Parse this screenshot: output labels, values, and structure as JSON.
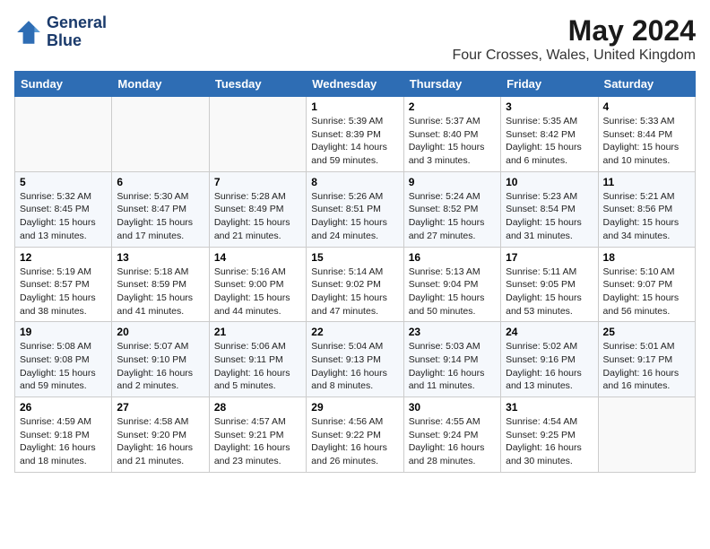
{
  "header": {
    "logo_line1": "General",
    "logo_line2": "Blue",
    "title": "May 2024",
    "subtitle": "Four Crosses, Wales, United Kingdom"
  },
  "days_of_week": [
    "Sunday",
    "Monday",
    "Tuesday",
    "Wednesday",
    "Thursday",
    "Friday",
    "Saturday"
  ],
  "weeks": [
    [
      {
        "day": "",
        "info": ""
      },
      {
        "day": "",
        "info": ""
      },
      {
        "day": "",
        "info": ""
      },
      {
        "day": "1",
        "info": "Sunrise: 5:39 AM\nSunset: 8:39 PM\nDaylight: 14 hours\nand 59 minutes."
      },
      {
        "day": "2",
        "info": "Sunrise: 5:37 AM\nSunset: 8:40 PM\nDaylight: 15 hours\nand 3 minutes."
      },
      {
        "day": "3",
        "info": "Sunrise: 5:35 AM\nSunset: 8:42 PM\nDaylight: 15 hours\nand 6 minutes."
      },
      {
        "day": "4",
        "info": "Sunrise: 5:33 AM\nSunset: 8:44 PM\nDaylight: 15 hours\nand 10 minutes."
      }
    ],
    [
      {
        "day": "5",
        "info": "Sunrise: 5:32 AM\nSunset: 8:45 PM\nDaylight: 15 hours\nand 13 minutes."
      },
      {
        "day": "6",
        "info": "Sunrise: 5:30 AM\nSunset: 8:47 PM\nDaylight: 15 hours\nand 17 minutes."
      },
      {
        "day": "7",
        "info": "Sunrise: 5:28 AM\nSunset: 8:49 PM\nDaylight: 15 hours\nand 21 minutes."
      },
      {
        "day": "8",
        "info": "Sunrise: 5:26 AM\nSunset: 8:51 PM\nDaylight: 15 hours\nand 24 minutes."
      },
      {
        "day": "9",
        "info": "Sunrise: 5:24 AM\nSunset: 8:52 PM\nDaylight: 15 hours\nand 27 minutes."
      },
      {
        "day": "10",
        "info": "Sunrise: 5:23 AM\nSunset: 8:54 PM\nDaylight: 15 hours\nand 31 minutes."
      },
      {
        "day": "11",
        "info": "Sunrise: 5:21 AM\nSunset: 8:56 PM\nDaylight: 15 hours\nand 34 minutes."
      }
    ],
    [
      {
        "day": "12",
        "info": "Sunrise: 5:19 AM\nSunset: 8:57 PM\nDaylight: 15 hours\nand 38 minutes."
      },
      {
        "day": "13",
        "info": "Sunrise: 5:18 AM\nSunset: 8:59 PM\nDaylight: 15 hours\nand 41 minutes."
      },
      {
        "day": "14",
        "info": "Sunrise: 5:16 AM\nSunset: 9:00 PM\nDaylight: 15 hours\nand 44 minutes."
      },
      {
        "day": "15",
        "info": "Sunrise: 5:14 AM\nSunset: 9:02 PM\nDaylight: 15 hours\nand 47 minutes."
      },
      {
        "day": "16",
        "info": "Sunrise: 5:13 AM\nSunset: 9:04 PM\nDaylight: 15 hours\nand 50 minutes."
      },
      {
        "day": "17",
        "info": "Sunrise: 5:11 AM\nSunset: 9:05 PM\nDaylight: 15 hours\nand 53 minutes."
      },
      {
        "day": "18",
        "info": "Sunrise: 5:10 AM\nSunset: 9:07 PM\nDaylight: 15 hours\nand 56 minutes."
      }
    ],
    [
      {
        "day": "19",
        "info": "Sunrise: 5:08 AM\nSunset: 9:08 PM\nDaylight: 15 hours\nand 59 minutes."
      },
      {
        "day": "20",
        "info": "Sunrise: 5:07 AM\nSunset: 9:10 PM\nDaylight: 16 hours\nand 2 minutes."
      },
      {
        "day": "21",
        "info": "Sunrise: 5:06 AM\nSunset: 9:11 PM\nDaylight: 16 hours\nand 5 minutes."
      },
      {
        "day": "22",
        "info": "Sunrise: 5:04 AM\nSunset: 9:13 PM\nDaylight: 16 hours\nand 8 minutes."
      },
      {
        "day": "23",
        "info": "Sunrise: 5:03 AM\nSunset: 9:14 PM\nDaylight: 16 hours\nand 11 minutes."
      },
      {
        "day": "24",
        "info": "Sunrise: 5:02 AM\nSunset: 9:16 PM\nDaylight: 16 hours\nand 13 minutes."
      },
      {
        "day": "25",
        "info": "Sunrise: 5:01 AM\nSunset: 9:17 PM\nDaylight: 16 hours\nand 16 minutes."
      }
    ],
    [
      {
        "day": "26",
        "info": "Sunrise: 4:59 AM\nSunset: 9:18 PM\nDaylight: 16 hours\nand 18 minutes."
      },
      {
        "day": "27",
        "info": "Sunrise: 4:58 AM\nSunset: 9:20 PM\nDaylight: 16 hours\nand 21 minutes."
      },
      {
        "day": "28",
        "info": "Sunrise: 4:57 AM\nSunset: 9:21 PM\nDaylight: 16 hours\nand 23 minutes."
      },
      {
        "day": "29",
        "info": "Sunrise: 4:56 AM\nSunset: 9:22 PM\nDaylight: 16 hours\nand 26 minutes."
      },
      {
        "day": "30",
        "info": "Sunrise: 4:55 AM\nSunset: 9:24 PM\nDaylight: 16 hours\nand 28 minutes."
      },
      {
        "day": "31",
        "info": "Sunrise: 4:54 AM\nSunset: 9:25 PM\nDaylight: 16 hours\nand 30 minutes."
      },
      {
        "day": "",
        "info": ""
      }
    ]
  ]
}
